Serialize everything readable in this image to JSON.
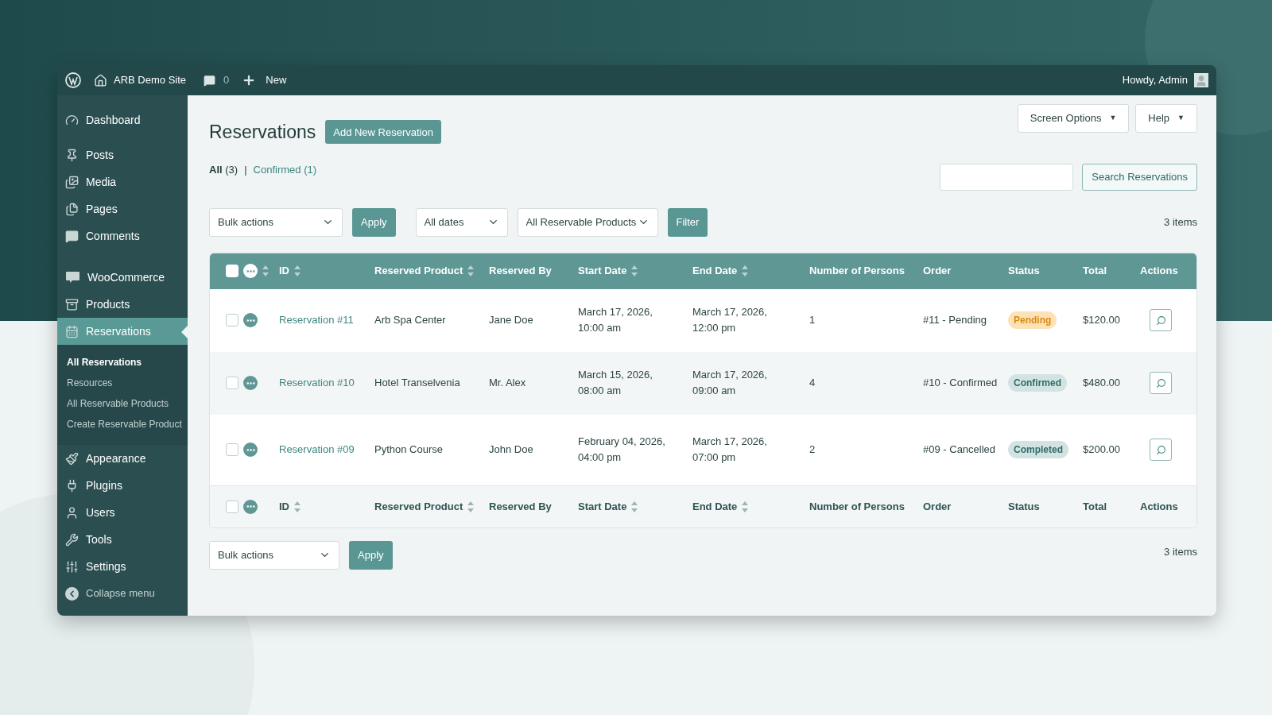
{
  "topbar": {
    "site": "ARB Demo Site",
    "comments": "0",
    "new": "New",
    "greeting": "Howdy, Admin"
  },
  "sidebar": {
    "sections": [
      [
        {
          "label": "Dashboard",
          "selected": false
        }
      ],
      [
        {
          "label": "Posts",
          "selected": false
        },
        {
          "label": "Media",
          "selected": false
        },
        {
          "label": "Pages",
          "selected": false
        },
        {
          "label": "Comments",
          "selected": false
        }
      ],
      [
        {
          "label": "WooCommerce",
          "selected": false
        },
        {
          "label": "Products",
          "selected": false
        },
        {
          "label": "Reservations",
          "selected": true,
          "children": [
            {
              "label": "All Reservations",
              "selected": true
            },
            {
              "label": "Resources",
              "selected": false
            },
            {
              "label": "All Reservable Products",
              "selected": false
            },
            {
              "label": "Create Reservable Product",
              "selected": false
            }
          ]
        }
      ],
      [
        {
          "label": "Appearance",
          "selected": false
        },
        {
          "label": "Plugins",
          "selected": false
        },
        {
          "label": "Users",
          "selected": false
        },
        {
          "label": "Tools",
          "selected": false
        },
        {
          "label": "Settings",
          "selected": false
        }
      ]
    ],
    "collapse": "Collapse menu"
  },
  "header": {
    "title": "Reservations",
    "add_button": "Add New Reservation",
    "screen_options": "Screen Options",
    "screen_options_caret": "▼",
    "help": "Help",
    "help_caret": "▼"
  },
  "views": [
    {
      "label": "All",
      "count": "(3)",
      "selected": true
    },
    {
      "label": "Confirmed",
      "count": "(1)",
      "selected": false
    }
  ],
  "views_separator": "|",
  "search": {
    "button": "Search Reservations"
  },
  "top_nav": {
    "bulk": "Bulk actions",
    "apply": "Apply",
    "dates": "All dates",
    "products": "All Reservable Products",
    "filter": "Filter",
    "count": "3 items"
  },
  "table": {
    "header": [
      {
        "label": "ID",
        "sortable": true
      },
      {
        "label": "Reserved Product",
        "sortable": true
      },
      {
        "label": "Reserved By",
        "sortable": false
      },
      {
        "label": "Start Date",
        "sortable": true
      },
      {
        "label": "End Date",
        "sortable": true
      },
      {
        "label": "Number of Persons",
        "sortable": false
      },
      {
        "label": "Order",
        "sortable": false
      },
      {
        "label": "Status",
        "sortable": false
      },
      {
        "label": "Total",
        "sortable": false
      },
      {
        "label": "Actions",
        "sortable": false
      }
    ],
    "header_more_sortable": true,
    "header_checked": false,
    "footer_checked": false,
    "rows": [
      {
        "checked": false,
        "id": "Reservation #11",
        "product": "Arb Spa Center",
        "by": "Jane Doe",
        "start": [
          "March 17, 2026,",
          "10:00 am"
        ],
        "end": [
          "March 17, 2026,",
          "12:00 pm"
        ],
        "persons": "1",
        "order": "#11 - Pending",
        "status": {
          "label": "Pending",
          "kind": "pending"
        },
        "total": "$120.00"
      },
      {
        "checked": false,
        "id": "Reservation #10",
        "product": "Hotel Transelvenia",
        "by": "Mr. Alex",
        "start": [
          "March 15, 2026,",
          "08:00 am"
        ],
        "end": [
          "March 17, 2026,",
          "09:00 am"
        ],
        "persons": "4",
        "order": "#10 - Confirmed",
        "status": {
          "label": "Confirmed",
          "kind": "confirmed"
        },
        "total": "$480.00"
      },
      {
        "checked": false,
        "id": "Reservation #09",
        "product": "Python Course",
        "by": "John Doe",
        "start": [
          "February 04, 2026,",
          "04:00 pm"
        ],
        "end": [
          "March 17, 2026,",
          "07:00 pm"
        ],
        "persons": "2",
        "order": "#09 - Cancelled",
        "status": {
          "label": "Completed",
          "kind": "completed"
        },
        "total": "$200.00"
      }
    ],
    "footer": [
      {
        "label": "ID",
        "sortable": true
      },
      {
        "label": "Reserved Product",
        "sortable": true
      },
      {
        "label": "Reserved By",
        "sortable": false
      },
      {
        "label": "Start Date",
        "sortable": true
      },
      {
        "label": "End Date",
        "sortable": true
      },
      {
        "label": "Number of Persons",
        "sortable": false
      },
      {
        "label": "Order",
        "sortable": false
      },
      {
        "label": "Status",
        "sortable": false
      },
      {
        "label": "Total",
        "sortable": false
      },
      {
        "label": "Actions",
        "sortable": false
      }
    ],
    "footer_more_sortable": false
  },
  "bottom_nav": {
    "bulk": "Bulk actions",
    "apply": "Apply",
    "count": "3 items"
  }
}
